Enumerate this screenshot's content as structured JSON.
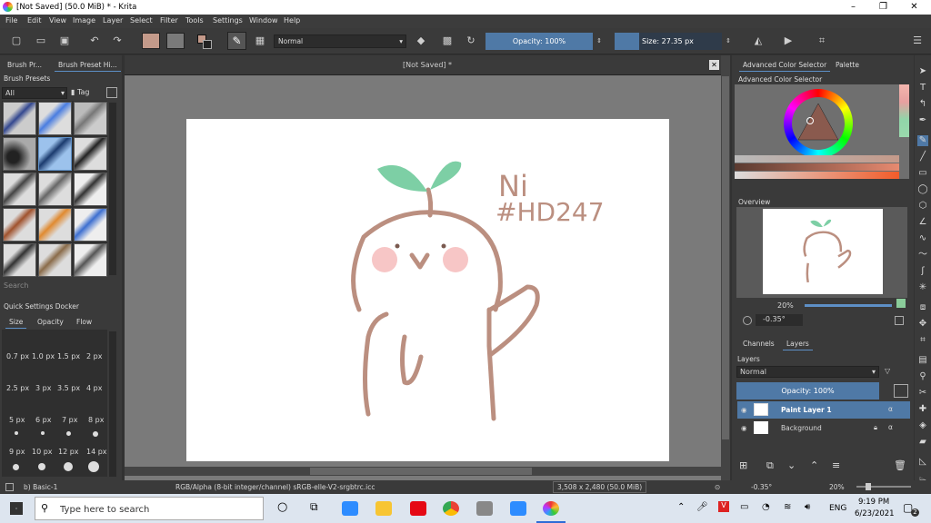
{
  "window": {
    "title": "[Not Saved]  (50.0 MiB)  * - Krita",
    "min": "–",
    "max": "❐",
    "close": "✕"
  },
  "menu": [
    "File",
    "Edit",
    "View",
    "Image",
    "Layer",
    "Select",
    "Filter",
    "Tools",
    "Settings",
    "Window",
    "Help"
  ],
  "toolbar": {
    "blend_mode": "Normal",
    "opacity": "Opacity: 100%",
    "size": "Size: 27.35 px"
  },
  "left": {
    "tab_brush_presets": "Brush Pr...",
    "tab_brush_history": "Brush Preset Hi...",
    "docker_title": "Brush Presets",
    "filter": "All",
    "tag": "Tag",
    "search_placeholder": "Search",
    "quick_settings_title": "Quick Settings Docker",
    "qs_tabs": [
      "Size",
      "Opacity",
      "Flow"
    ],
    "qs_rows": [
      [
        "0.7 px",
        "1.0 px",
        "1.5 px",
        "2 px"
      ],
      [
        "2.5 px",
        "3 px",
        "3.5 px",
        "4 px"
      ],
      [
        "5 px",
        "6 px",
        "7 px",
        "8 px"
      ],
      [
        "9 px",
        "10 px",
        "12 px",
        "14 px"
      ]
    ]
  },
  "canvas": {
    "doc_tab": "[Not Saved]  *",
    "drawing_text_line1": "Ni",
    "drawing_text_line2": "#HD247"
  },
  "right": {
    "tab_color_selector": "Advanced Color Selector",
    "tab_palette": "Palette",
    "color_selector_title": "Advanced Color Selector",
    "overview_title": "Overview",
    "overview_zoom": "20%",
    "overview_rotation": "-0.35°",
    "tab_channels": "Channels",
    "tab_layers": "Layers",
    "layers_title": "Layers",
    "layers_blend": "Normal",
    "layers_opacity": "Opacity:  100%",
    "layers": [
      {
        "name": "Paint Layer 1",
        "selected": true
      },
      {
        "name": "Background",
        "selected": false
      }
    ]
  },
  "status": {
    "brush": "b) Basic-1",
    "color_space": "RGB/Alpha (8-bit integer/channel)  sRGB-elle-V2-srgbtrc.icc",
    "dimensions": "3,508 x 2,480 (50.0 MiB)",
    "rotation": "-0.35°",
    "zoom": "20%"
  },
  "taskbar": {
    "search_placeholder": "Type here to search",
    "lang": "ENG",
    "time": "9:19 PM",
    "date": "6/23/2021",
    "notif_count": "2"
  },
  "colors": {
    "fg": "#c49a8a",
    "bg": "#7a7a7a",
    "sprout": "#7dcfa5",
    "line": "#bb8f80",
    "cheek": "#f7c6c6"
  }
}
